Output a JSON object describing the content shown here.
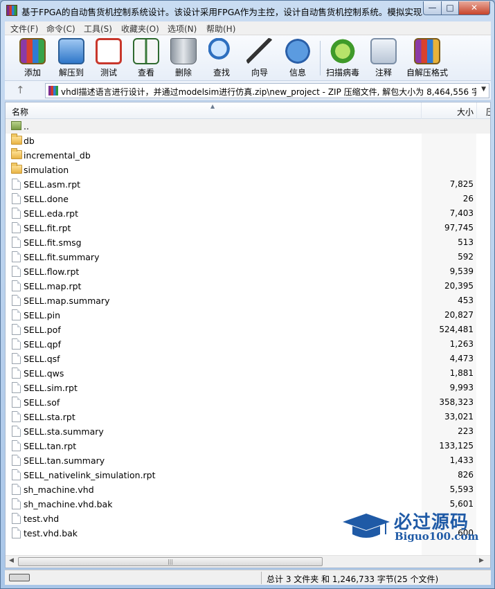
{
  "window": {
    "title": "基于FPGA的自动售货机控制系统设计。该设计采用FPGA作为主控，设计自动售货机控制系统。模拟实现...",
    "min_label": "—",
    "max_label": "□",
    "close_label": "✕"
  },
  "menu": [
    "文件(F)",
    "命令(C)",
    "工具(S)",
    "收藏夹(O)",
    "选项(N)",
    "帮助(H)"
  ],
  "toolbar": [
    {
      "label": "添加",
      "icon": "add-archive-icon"
    },
    {
      "label": "解压到",
      "icon": "extract-to-icon"
    },
    {
      "label": "测试",
      "icon": "test-icon"
    },
    {
      "label": "查看",
      "icon": "view-icon"
    },
    {
      "label": "删除",
      "icon": "delete-icon"
    },
    {
      "label": "查找",
      "icon": "find-icon"
    },
    {
      "label": "向导",
      "icon": "wizard-icon"
    },
    {
      "label": "信息",
      "icon": "info-icon"
    },
    {
      "label": "扫描病毒",
      "icon": "virus-scan-icon"
    },
    {
      "label": "注释",
      "icon": "comment-icon"
    },
    {
      "label": "自解压格式",
      "icon": "sfx-icon"
    }
  ],
  "address": {
    "up_arrow": "↑",
    "path": "vhdl描述语言进行设计，并通过modelsim进行仿真.zip\\new_project - ZIP 压缩文件, 解包大小为 8,464,556 字节",
    "dropdown": "▼"
  },
  "columns": {
    "name": "名称",
    "size": "大小",
    "extra": "压"
  },
  "files": [
    {
      "name": "..",
      "size": "",
      "type": "up"
    },
    {
      "name": "db",
      "size": "",
      "type": "folder"
    },
    {
      "name": "incremental_db",
      "size": "",
      "type": "folder"
    },
    {
      "name": "simulation",
      "size": "",
      "type": "folder"
    },
    {
      "name": "SELL.asm.rpt",
      "size": "7,825",
      "type": "file"
    },
    {
      "name": "SELL.done",
      "size": "26",
      "type": "file"
    },
    {
      "name": "SELL.eda.rpt",
      "size": "7,403",
      "type": "file"
    },
    {
      "name": "SELL.fit.rpt",
      "size": "97,745",
      "type": "file"
    },
    {
      "name": "SELL.fit.smsg",
      "size": "513",
      "type": "file"
    },
    {
      "name": "SELL.fit.summary",
      "size": "592",
      "type": "file"
    },
    {
      "name": "SELL.flow.rpt",
      "size": "9,539",
      "type": "file"
    },
    {
      "name": "SELL.map.rpt",
      "size": "20,395",
      "type": "file"
    },
    {
      "name": "SELL.map.summary",
      "size": "453",
      "type": "file"
    },
    {
      "name": "SELL.pin",
      "size": "20,827",
      "type": "file"
    },
    {
      "name": "SELL.pof",
      "size": "524,481",
      "type": "file"
    },
    {
      "name": "SELL.qpf",
      "size": "1,263",
      "type": "file"
    },
    {
      "name": "SELL.qsf",
      "size": "4,473",
      "type": "file"
    },
    {
      "name": "SELL.qws",
      "size": "1,881",
      "type": "file"
    },
    {
      "name": "SELL.sim.rpt",
      "size": "9,993",
      "type": "file"
    },
    {
      "name": "SELL.sof",
      "size": "358,323",
      "type": "file"
    },
    {
      "name": "SELL.sta.rpt",
      "size": "33,021",
      "type": "file"
    },
    {
      "name": "SELL.sta.summary",
      "size": "223",
      "type": "file"
    },
    {
      "name": "SELL.tan.rpt",
      "size": "133,125",
      "type": "file"
    },
    {
      "name": "SELL.tan.summary",
      "size": "1,433",
      "type": "file"
    },
    {
      "name": "SELL_nativelink_simulation.rpt",
      "size": "826",
      "type": "file"
    },
    {
      "name": "sh_machine.vhd",
      "size": "5,593",
      "type": "file"
    },
    {
      "name": "sh_machine.vhd.bak",
      "size": "5,601",
      "type": "file"
    },
    {
      "name": "test.vhd",
      "size": "",
      "type": "file"
    },
    {
      "name": "test.vhd.bak",
      "size": "600",
      "type": "file"
    }
  ],
  "scrollbar": {
    "left": "◀",
    "right": "▶",
    "grip": "|||"
  },
  "status": {
    "text": "总计 3 文件夹 和 1,246,733 字节(25 个文件)"
  },
  "watermark": {
    "line1": "必过源码",
    "line2": "Biguo100.com",
    "color": "#1f5aa6"
  }
}
